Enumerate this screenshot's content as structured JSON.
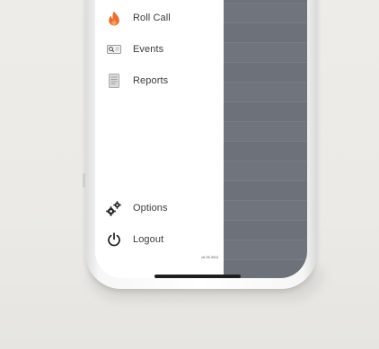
{
  "menu": {
    "items": [
      {
        "label": "Roll Call",
        "icon": "flame-icon"
      },
      {
        "label": "Events",
        "icon": "events-icon"
      },
      {
        "label": "Reports",
        "icon": "report-icon"
      }
    ],
    "bottom_items": [
      {
        "label": "Options",
        "icon": "gears-icon"
      },
      {
        "label": "Logout",
        "icon": "power-icon"
      }
    ]
  },
  "version": "v6.05.3911",
  "colors": {
    "overlay": "#6d7179",
    "accent_flame": "#f26a2a",
    "background": "#ebeae6"
  }
}
